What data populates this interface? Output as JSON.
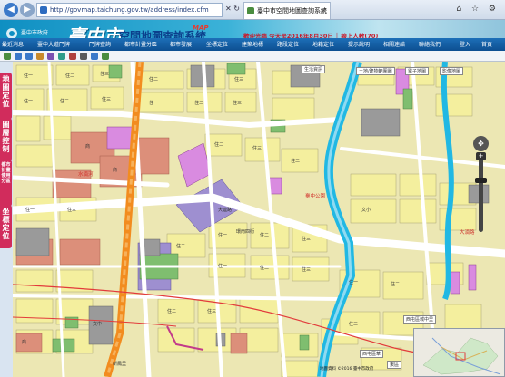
{
  "browser": {
    "url": "http://govmap.taichung.gov.tw/address/index.cfm",
    "tab_title": "臺中市空間地圖查詢系統",
    "tab_close": "×",
    "back_icon": "◀",
    "forward_icon": "▶",
    "toolbar_glyphs": "✕ ↻",
    "window_glyphs": "⌂ ☆ ⚙"
  },
  "header": {
    "emblem_text": "臺中市政府",
    "logo_main": "臺中市",
    "logo_title": "空間地圖查詢系統",
    "logo_tag": "MAP",
    "welcome": "歡迎光臨 今天是2016年8月30日 │ 線上人數(70)"
  },
  "menu": {
    "items": [
      "最近消息",
      "臺中大道門牌",
      "門牌查詢",
      "都市計畫分區",
      "都市發展",
      "坐標定位",
      "建築地標",
      "路段定位",
      "地籍定位",
      "提示說明",
      "相關連結",
      "聯絡我們",
      "登入",
      "首頁"
    ]
  },
  "side_tabs": [
    "地圖定位",
    "圖層控制",
    "都市計畫使用分區",
    "坐標定位"
  ],
  "map": {
    "labels_zone": [
      "住一",
      "住二",
      "住三",
      "住一",
      "住二",
      "住三",
      "住二",
      "住三",
      "住一",
      "住二",
      "住三",
      "住二",
      "商",
      "住三",
      "住二",
      "住一",
      "商",
      "住三",
      "住二",
      "住一",
      "住二",
      "住三",
      "住一",
      "住二",
      "住三",
      "文小",
      "文中",
      "住二",
      "住三",
      "商",
      "住一",
      "住二",
      "住三"
    ],
    "label_red_1": "水湳河",
    "label_red_2": "臺中公園",
    "label_red_3": "大湳路",
    "label_road_1": "大連路",
    "label_place_1": "新鳳里",
    "label_place_2": "環南四街",
    "sign_1": "生活資訊",
    "sign_2": "土地/建物範圍圖",
    "sign_3": "電子地圖",
    "sign_4": "影像地圖",
    "sign_5": "西屯區城中里",
    "sign_6": "西屯區華",
    "sign_7": "東區",
    "copyright": "地圖資料 ©2016 臺中市政府"
  },
  "colors": {
    "residential": "#f4ef9e",
    "commercial_red": "#dc8f7a",
    "purple": "#9e8fd0",
    "magenta": "#d98be0",
    "river": "#21b8e3",
    "road": "#ffffff",
    "green": "#7fbe6f",
    "gray": "#9a9a9a",
    "rail": "#f28c1f",
    "side_tab": "#d12c5c"
  }
}
